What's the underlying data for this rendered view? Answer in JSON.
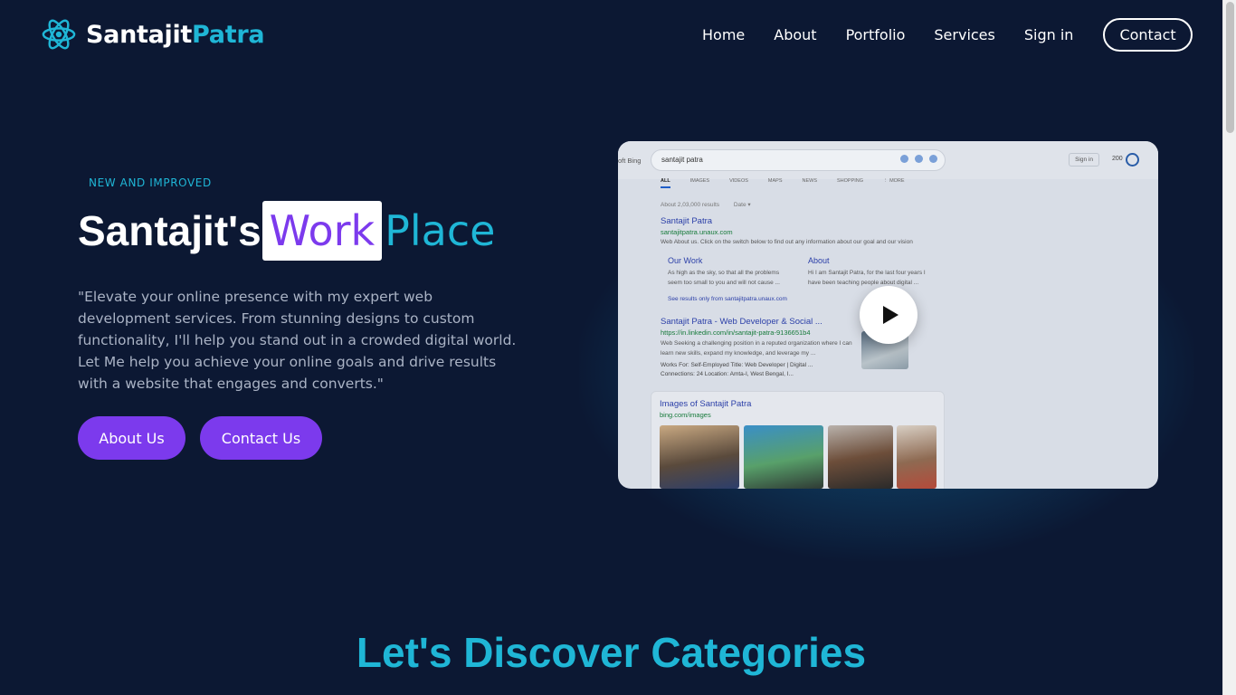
{
  "brand": {
    "part1": "Santajit",
    "part2": "Patra",
    "logo_icon": "atom-icon"
  },
  "nav": {
    "items": [
      "Home",
      "About",
      "Portfolio",
      "Services",
      "Sign in"
    ],
    "contact_label": "Contact"
  },
  "hero": {
    "eyebrow": "NEW AND IMPROVED",
    "title_part1": "Santajit's",
    "title_highlight": "Work",
    "title_part3": "Place",
    "description": "\"Elevate your online presence with my expert web development services. From stunning designs to custom functionality, I'll help you stand out in a crowded digital world. Let Me help you achieve your online goals and drive results with a website that engages and converts.\"",
    "buttons": {
      "about": "About Us",
      "contact": "Contact Us"
    }
  },
  "video": {
    "play_icon": "play-icon",
    "preview": {
      "bing_label": "oft Bing",
      "search_query": "santajit patra",
      "sign_in": "Sign in",
      "points": "200",
      "tabs": [
        "ALL",
        "IMAGES",
        "VIDEOS",
        "MAPS",
        "NEWS",
        "SHOPPING",
        "⋮ MORE"
      ],
      "results_count": "About 2,03,000 results",
      "date_filter": "Date ▾",
      "result1_title": "Santajit Patra",
      "result1_url": "santajitpatra.unaux.com",
      "result1_snippet": "Web  About us. Click on the switch below to find out any information about our goal and our vision",
      "sub1_title": "Our Work",
      "sub1_text": "As high as the sky, so that all the problems seem too small to you and will not cause ...",
      "sub2_title": "About",
      "sub2_text": "Hi I am Santajit Patra, for the last four years I have been teaching people about digital ...",
      "see_results": "See results only from santajitpatra.unaux.com",
      "result2_title": "Santajit Patra - Web Developer & Social ...",
      "result2_url": "https://in.linkedin.com/in/santajit-patra-9136651b4",
      "result2_snippet": "Web  Seeking a challenging position in a reputed organization where I can learn new skills, expand my knowledge, and leverage my ...",
      "result2_meta1": "Works For: Self-Employed     Title: Web Developer | Digital ...",
      "result2_meta2": "Connections: 24     Location: Amta-I, West Bengal, I...",
      "images_title": "Images of Santajit Patra",
      "images_url": "bing.com/images"
    }
  },
  "section": {
    "title": "Let's Discover Categories"
  },
  "colors": {
    "background": "#0c1833",
    "accent_cyan": "#1fb6d6",
    "accent_purple": "#7c3aed"
  }
}
